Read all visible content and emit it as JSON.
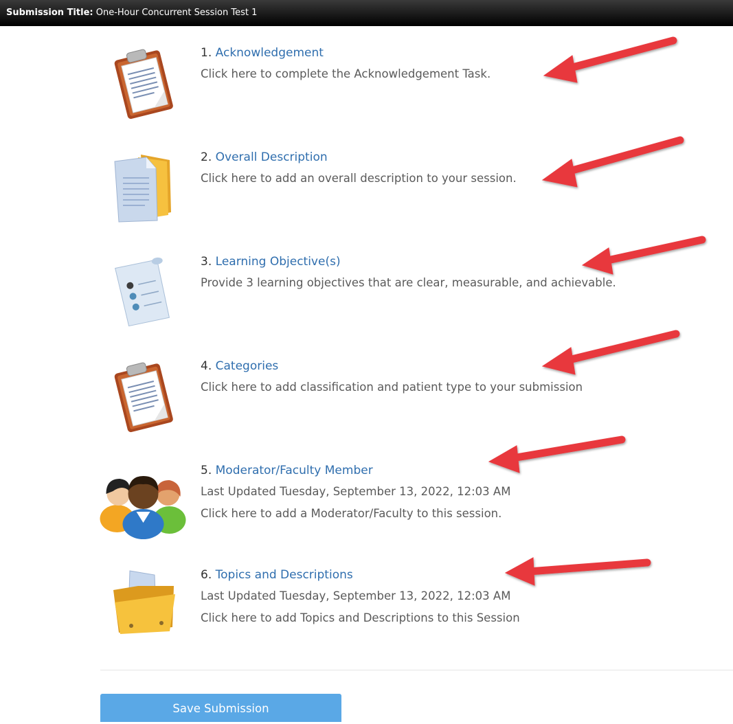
{
  "header": {
    "label": "Submission Title:",
    "value": "One-Hour Concurrent Session Test 1"
  },
  "tasks": [
    {
      "num": "1.",
      "title": "Acknowledgement",
      "icon": "clipboard-icon",
      "lines": [
        "Click here to complete the Acknowledgement Task."
      ]
    },
    {
      "num": "2.",
      "title": "Overall Description",
      "icon": "documents-folder-icon",
      "lines": [
        "Click here to add an overall description to your session."
      ]
    },
    {
      "num": "3.",
      "title": "Learning Objective(s)",
      "icon": "scroll-list-icon",
      "lines": [
        "Provide 3 learning objectives that are clear, measurable, and achievable."
      ]
    },
    {
      "num": "4.",
      "title": "Categories",
      "icon": "clipboard-icon",
      "lines": [
        "Click here to add classification and patient type to your submission"
      ]
    },
    {
      "num": "5.",
      "title": "Moderator/Faculty Member",
      "icon": "people-group-icon",
      "lines": [
        "Last Updated Tuesday, September 13, 2022, 12:03 AM",
        "Click here to add a Moderator/Faculty to this session."
      ]
    },
    {
      "num": "6.",
      "title": "Topics and Descriptions",
      "icon": "open-folder-icon",
      "lines": [
        "Last Updated Tuesday, September 13, 2022, 12:03 AM",
        "Click here to add Topics and Descriptions to this Session"
      ]
    }
  ],
  "save_button": "Save Submission",
  "colors": {
    "link": "#2f6eae",
    "arrow": "#e8383d",
    "button": "#5aa8e6",
    "titlebar": "#111111"
  }
}
